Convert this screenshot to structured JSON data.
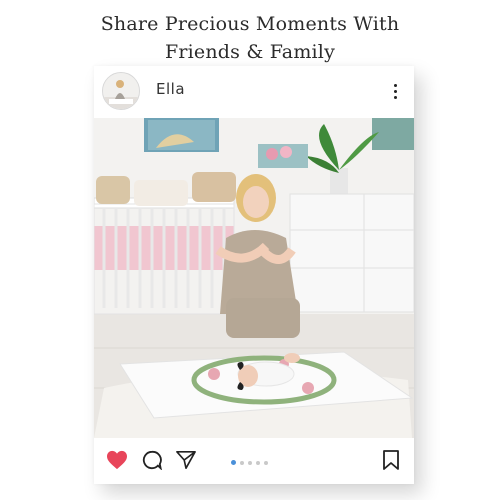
{
  "headline": {
    "line1": "Share Precious Moments With",
    "line2": "Friends & Family"
  },
  "post": {
    "username": "Ella",
    "carousel": {
      "total": 5,
      "active_index": 0
    }
  },
  "colors": {
    "like_red": "#e8455a",
    "carousel_active": "#4a90d9",
    "carousel_inactive": "#c9c9c9",
    "icon_dark": "#222222"
  },
  "icons": {
    "like": "heart-icon",
    "comment": "comment-icon",
    "share": "send-icon",
    "save": "bookmark-icon",
    "more": "more-vertical-icon"
  }
}
